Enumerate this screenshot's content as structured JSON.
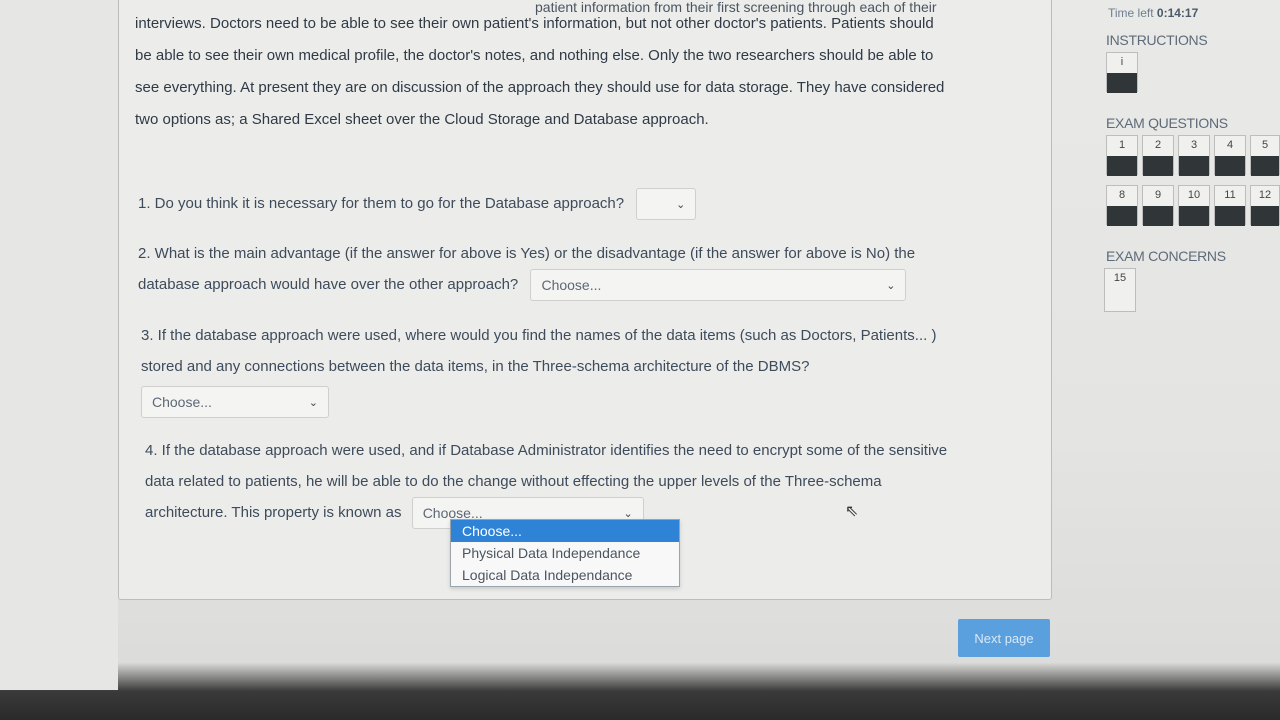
{
  "passage": {
    "line0": "patient information from their first screening through each of their",
    "line1": "interviews. Doctors need to be able to see their own patient's information, but not other doctor's patients. Patients should",
    "line2": "be able to see their own medical profile, the doctor's notes, and nothing else. Only the two researchers should be able to",
    "line3": "see everything. At present they are on discussion of the approach they should use for data storage. They have considered",
    "line4": "two options as; a Shared Excel sheet over the Cloud Storage and Database approach."
  },
  "questions": {
    "q1": {
      "text": "1. Do you think it is necessary for them to go for the Database approach?",
      "value": ""
    },
    "q2": {
      "line1": "2. What is the main advantage (if the answer for above is Yes) or the disadvantage (if the answer for above is No) the",
      "line2": "database approach would have over the other approach?",
      "value": "Choose..."
    },
    "q3": {
      "line1": "3. If the database approach were used, where would you find the names of the data items (such as Doctors, Patients... )",
      "line2": "stored and any connections between the data items, in the Three-schema architecture of the DBMS?",
      "value": "Choose..."
    },
    "q4": {
      "line1": "4. If the database approach were used, and if Database Administrator identifies the need to encrypt some of the sensitive",
      "line2": "data related to patients, he will be able to do the change without effecting the upper levels of the Three-schema",
      "line3": "architecture. This property is known as",
      "value": "Choose...",
      "options": [
        "Choose...",
        "Physical Data Independance",
        "Logical Data Independance"
      ]
    }
  },
  "next_label": "Next page",
  "sidebar": {
    "timer_label": "Time left",
    "timer_value": "0:14:17",
    "instructions_title": "INSTRUCTIONS",
    "instructions_btn": "i",
    "questions_title": "EXAM QUESTIONS",
    "q_row1": [
      "1",
      "2",
      "3",
      "4",
      "5"
    ],
    "q_row2": [
      "8",
      "9",
      "10",
      "11",
      "12"
    ],
    "concerns_title": "EXAM CONCERNS",
    "concerns_btn": "15"
  },
  "colors": {
    "accent": "#2f83d6",
    "button": "#5aa0df",
    "nav_fill": "#303537"
  }
}
